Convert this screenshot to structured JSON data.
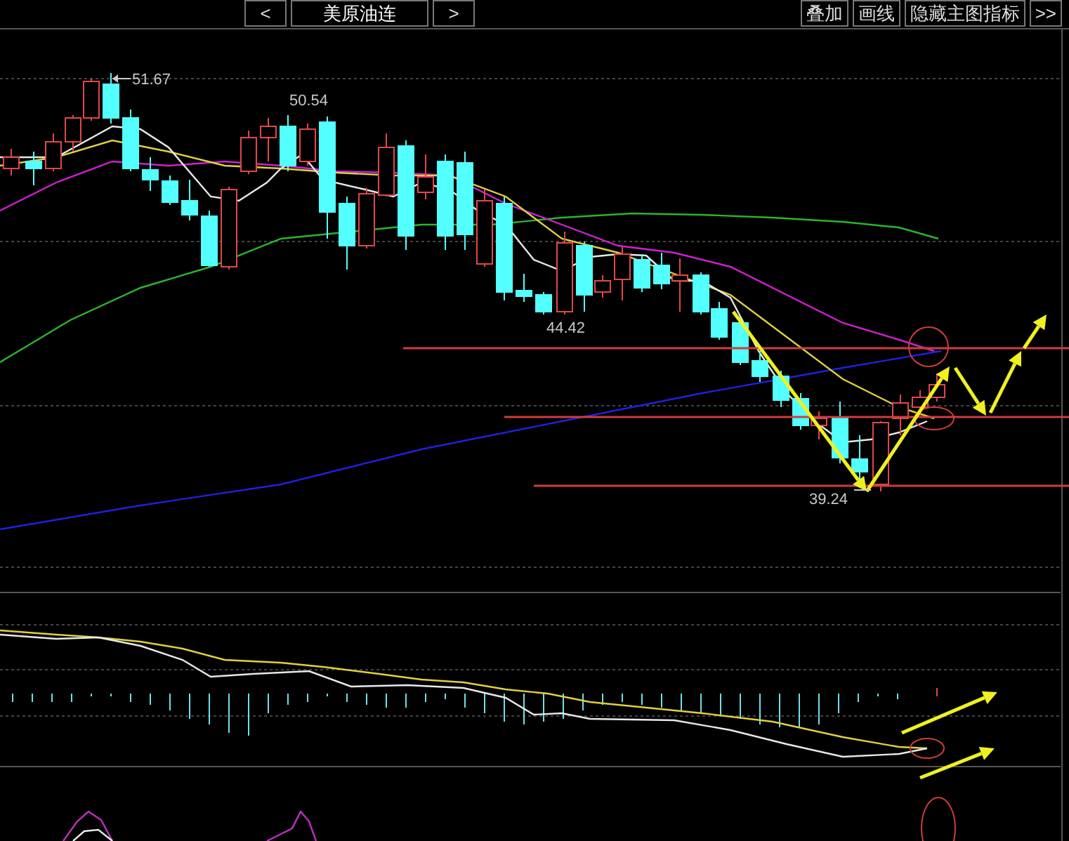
{
  "toolbar": {
    "prev": "<",
    "title": "美原油连",
    "next": ">",
    "buttons": [
      "叠加",
      "画线",
      "隐藏主图指标",
      ">>"
    ]
  },
  "price_labels": [
    {
      "kind": "high",
      "text": "51.67"
    },
    {
      "kind": "plain",
      "text": "50.54"
    },
    {
      "kind": "plain",
      "text": "44.42"
    },
    {
      "kind": "low",
      "text": "39.24"
    }
  ]
}
